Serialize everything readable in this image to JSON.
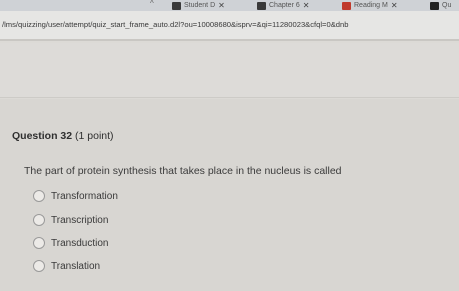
{
  "browser": {
    "tabs": [
      {
        "label": "Student D",
        "icon": "blackboard-icon",
        "icon_color": "#3a3a3a"
      },
      {
        "label": "Chapter 6",
        "icon": "book-icon",
        "icon_color": "#3a3a3a"
      },
      {
        "label": "Reading M",
        "icon": "m-icon",
        "icon_color": "#c0392b"
      },
      {
        "label": "Qu",
        "icon": "page-icon",
        "icon_color": "#222222"
      }
    ],
    "url": "/lms/quizzing/user/attempt/quiz_start_frame_auto.d2l?ou=10008680&isprv=&qi=11280023&cfql=0&dnb"
  },
  "quiz": {
    "question_label": "Question 32",
    "points": "(1 point)",
    "prompt": "The part of protein synthesis that takes place in the nucleus is called",
    "options": [
      "Transformation",
      "Transcription",
      "Transduction",
      "Translation"
    ]
  }
}
